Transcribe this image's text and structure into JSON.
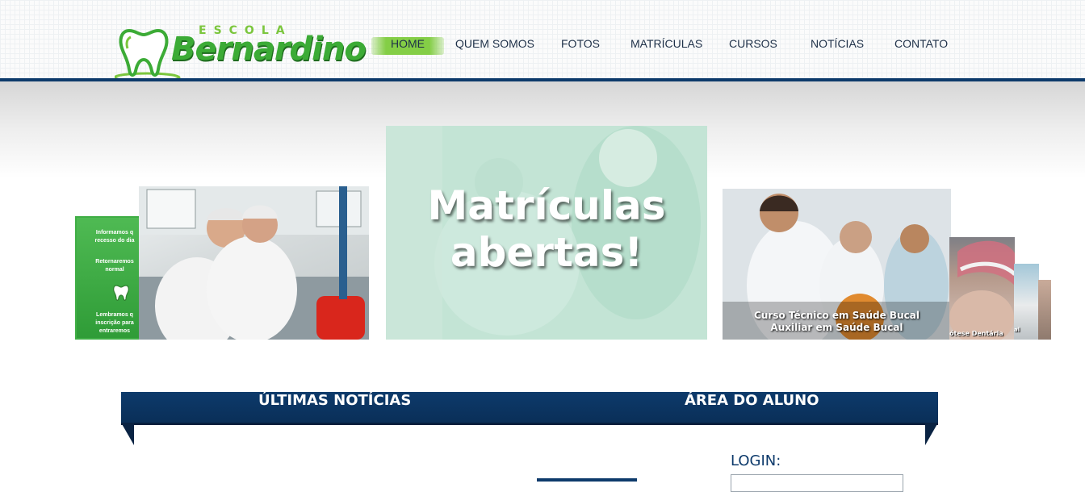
{
  "header": {
    "logo": {
      "top": "ESCOLA",
      "name": "Bernardino"
    },
    "nav": [
      {
        "label": "HOME",
        "active": true
      },
      {
        "label": "QUEM SOMOS"
      },
      {
        "label": "FOTOS"
      },
      {
        "label": "MATRÍCULAS"
      },
      {
        "label": "CURSOS"
      },
      {
        "label": "NOTÍCIAS"
      },
      {
        "label": "CONTATO"
      }
    ],
    "accent_color": "#0d3a6b",
    "nav_active_color": "#84ce46"
  },
  "slider": {
    "notice": {
      "line1": "Informamos q",
      "line2": "recesso do dia",
      "line3": "Retornaremos",
      "line4": "normal",
      "line5": "Lembramos q",
      "line6": "inscrição para",
      "line7": "entraremos"
    },
    "main": {
      "line1": "Matrículas",
      "line2": "abertas!"
    },
    "clinic": {
      "line1": "Curso Técnico em Saúde Bucal",
      "line2": "Auxiliar em Saúde Bucal"
    },
    "prosthesis": {
      "caption": "ótese Dentária"
    },
    "small": {
      "caption": "al"
    }
  },
  "panel": {
    "news_title": "ÚLTIMAS NOTÍCIAS",
    "student_title": "ÁREA DO ALUNO",
    "login_label": "LOGIN:",
    "login_value": ""
  }
}
